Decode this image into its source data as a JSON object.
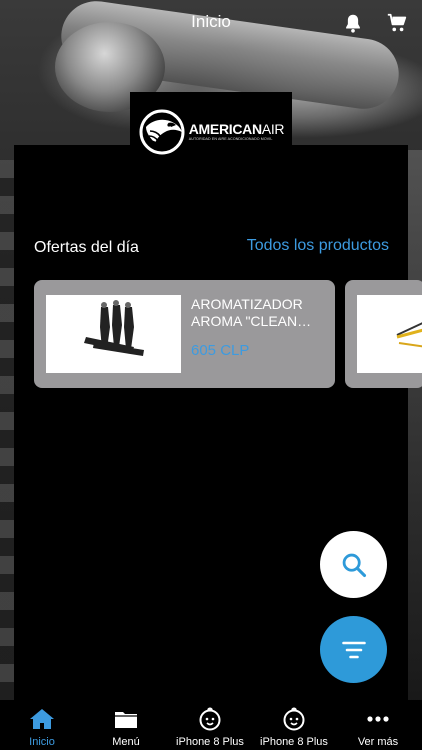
{
  "header": {
    "title": "Inicio",
    "icons": [
      "bell-icon",
      "cart-icon"
    ]
  },
  "logo": {
    "brand_bold": "AMERICAN",
    "brand_light": "AIR",
    "tagline": "AUTORIDAD EN AIRE ACONDICIONADO MOVIL"
  },
  "offers": {
    "title": "Ofertas del día",
    "all_products_link": "Todos los productos",
    "products": [
      {
        "name": "AROMATIZADOR AROMA \"CLEAN…",
        "price": "605 CLP"
      }
    ]
  },
  "tabbar": {
    "tabs": [
      {
        "label": "Inicio",
        "icon": "home-icon",
        "active": true
      },
      {
        "label": "Menú",
        "icon": "folder-icon",
        "active": false
      },
      {
        "label": "iPhone 8 Plus",
        "icon": "face-icon",
        "active": false
      },
      {
        "label": "iPhone 8 Plus",
        "icon": "face-icon",
        "active": false
      },
      {
        "label": "Ver más",
        "icon": "more-icon",
        "active": false
      }
    ]
  },
  "colors": {
    "accent": "#3d9be0",
    "fab_blue": "#2e9ad9",
    "card_bg": "#9a999b"
  }
}
